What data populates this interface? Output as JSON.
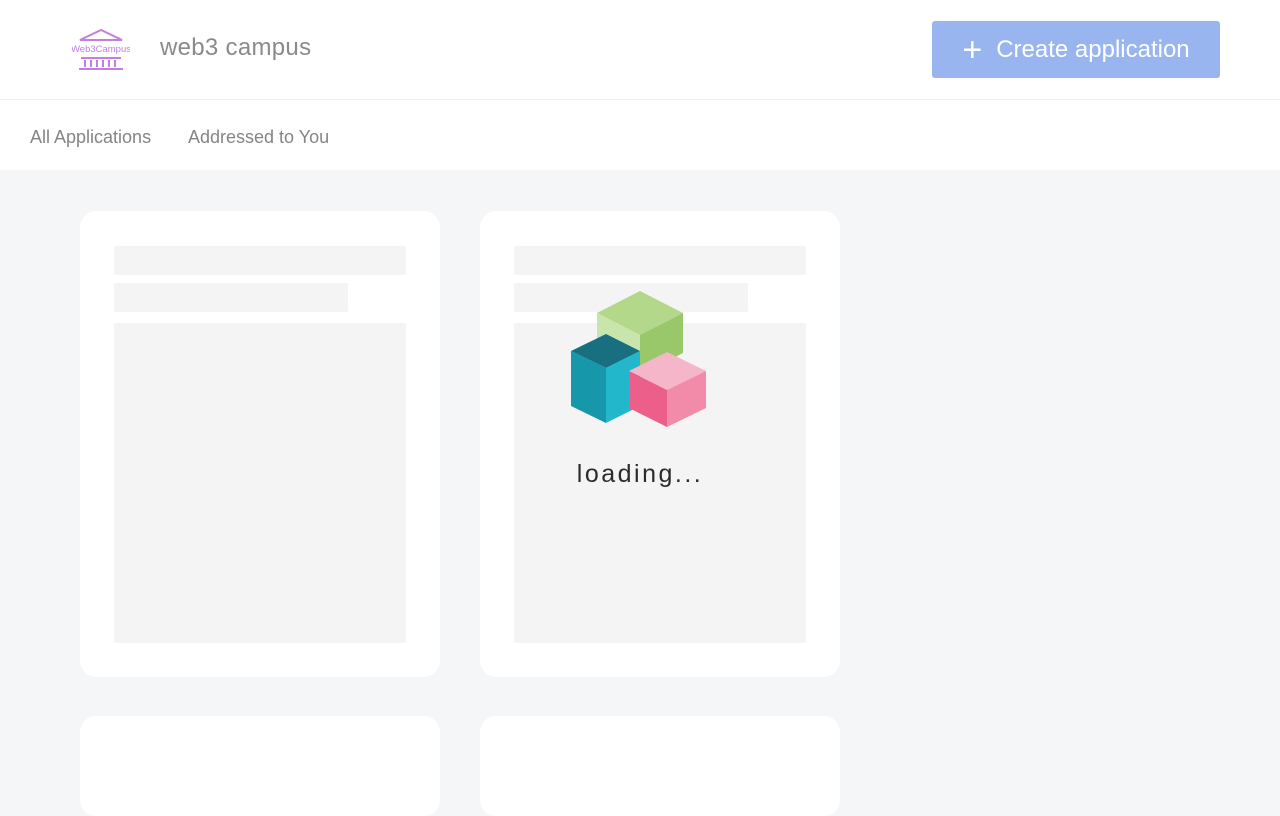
{
  "header": {
    "logo_text": "Web3Campus",
    "brand_name": "web3 campus",
    "create_button": {
      "icon": "plus-icon",
      "label": "Create application"
    }
  },
  "tabs": [
    {
      "label": "All Applications"
    },
    {
      "label": "Addressed to You"
    }
  ],
  "loader": {
    "text": "loading...",
    "icon": "cubes-icon"
  },
  "colors": {
    "accent": "#98b5ef",
    "logo": "#c27fe0",
    "background": "#f5f6f8",
    "skeleton": "#f4f4f5"
  }
}
